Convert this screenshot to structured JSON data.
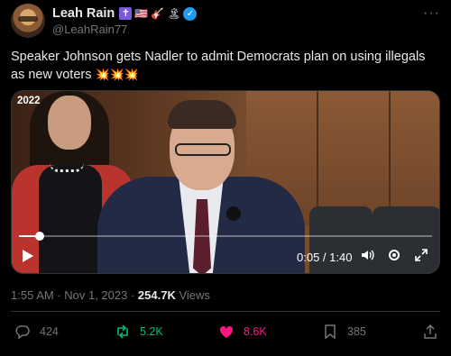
{
  "author": {
    "display_name": "Leah Rain",
    "badges": [
      "✝",
      "🇺🇸",
      "🎸",
      "🏝"
    ],
    "handle": "@LeahRain77",
    "verified": true
  },
  "tweet": {
    "text": "Speaker Johnson gets Nadler to admit Democrats plan on using illegals as new voters",
    "emoji_suffix": "💥💥💥"
  },
  "video": {
    "year_label": "2022",
    "current_time": "0:05",
    "duration": "1:40",
    "time_display": "0:05 / 1:40",
    "progress_fraction": 0.05
  },
  "meta": {
    "timestamp": "1:55 AM · Nov 1, 2023 · ",
    "views_count": "254.7K",
    "views_label": "Views"
  },
  "actions": {
    "replies": "424",
    "reposts": "5.2K",
    "likes": "8.6K",
    "bookmarks": "385"
  },
  "colors": {
    "background": "#000000",
    "text_primary": "#e7e9ea",
    "text_secondary": "#71767b",
    "repost_green": "#00ba7c",
    "like_pink": "#f91880",
    "verified_blue": "#1d9bf0"
  }
}
